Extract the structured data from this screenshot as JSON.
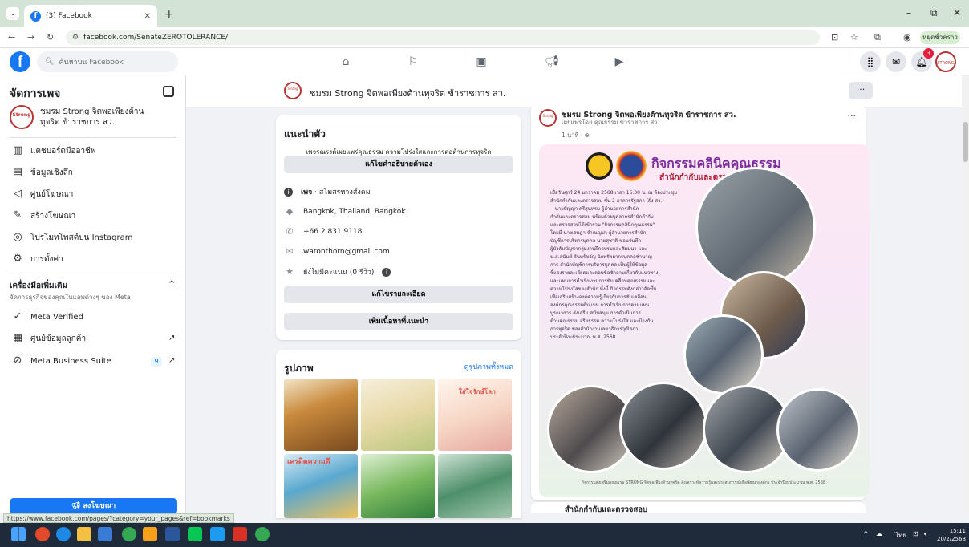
{
  "browser": {
    "tab_title": "(3) Facebook",
    "url": "facebook.com/SenateZEROTOLERANCE/",
    "profile_label": "หยุดชั่วคราว",
    "status_url": "https://www.facebook.com/pages/?category=your_pages&ref=bookmarks"
  },
  "fbnav": {
    "search_placeholder": "ค้นหาบน Facebook",
    "notification_count": "3"
  },
  "sidebar": {
    "title": "จัดการเพจ",
    "page_name": "ชมรม Strong จิตพอเพียงต้านทุจริต ข้าราชการ สว.",
    "items": [
      {
        "label": "แดชบอร์ดมืออาชีพ",
        "icon": "dashboard-icon"
      },
      {
        "label": "ข้อมูลเชิงลึก",
        "icon": "insights-icon"
      },
      {
        "label": "ศูนย์โฆษณา",
        "icon": "megaphone-icon"
      },
      {
        "label": "สร้างโฆษณา",
        "icon": "edit-icon"
      },
      {
        "label": "โปรโมทโพสต์บน Instagram",
        "icon": "instagram-icon"
      },
      {
        "label": "การตั้งค่า",
        "icon": "gear-icon"
      }
    ],
    "tools_heading": "เครื่องมือเพิ่มเติม",
    "tools_sub": "จัดการธุรกิจของคุณในแอพต่างๆ ของ Meta",
    "tools": [
      {
        "label": "Meta Verified",
        "icon": "verified-icon"
      },
      {
        "label": "ศูนย์ข้อมูลลูกค้า",
        "icon": "contacts-icon"
      },
      {
        "label": "Meta Business Suite",
        "icon": "business-suite-icon",
        "count": "9"
      }
    ],
    "promote_label": "ลงโฆษณา"
  },
  "page_header": {
    "name": "ชมรม Strong จิตพอเพียงต้านทุจริต ข้าราชการ สว.",
    "more": "···"
  },
  "intro": {
    "heading": "แนะนำตัว",
    "bio": "เพจรณรงค์เผยแพร่คุณธรรม ความโปร่งใสและการต่อต้านการทุจริต",
    "edit_bio": "แก้ไขคำอธิบายตัวเอง",
    "category_bold": "เพจ",
    "category": " · สโมสรทางสังคม",
    "location": "Bangkok, Thailand, Bangkok",
    "phone": "+66 2 831 9118",
    "email": "waronthorn@gmail.com",
    "rating": "ยังไม่มีคะแนน (0 รีวิว)",
    "edit_details": "แก้ไขรายละเอียด",
    "add_featured": "เพิ่มเนื้อหาที่แนะนำ"
  },
  "photos": {
    "heading": "รูปภาพ",
    "see_all": "ดูรูปภาพทั้งหมด",
    "thumb1_text": "เครดิตความดี",
    "thumb2_text": "ใส่ใจรักษ์โลก"
  },
  "post": {
    "author": "ชมรม Strong จิตพอเพียงต้านทุจริต ข้าราชการ สว.",
    "by": "เผยแพร่โดย คุณธรรม ข้าราชการ สว.",
    "time": "1 นาที · ",
    "more": "···",
    "poster_title": "กิจกรรมคลินิคคุณธรรม",
    "poster_subtitle": "สำนักกำกับและตรวจสอบ",
    "poster_body": "เมื่อวันศุกร์ 24 มกราคม 2568 เวลา 15.00 น. ณ ห้องประชุม\nสำนักกำกับและตรวจสอบ ชั้น 2 อาคารรัฐสภา (ฝั่ง สว.)\n   นายปัญญา ศรีสุนทรม ผู้อำนวยการสำนัก\nกำกับและตรวจสอบ พร้อมด้วยบุคลากรสำนักกำกับ\nและตรวจสอบได้เข้าร่วม \"กิจกรรมคลินิกคุณธรรม\"\nโดยมี นางเจษฎา จำเนญปา ผู้อำนวยการสำนัก\nบัญชีการบริหารบุคคล นายสุชาติ ขอมจันทึก\nผู้บังคับบัญชากลุ่มงานฝึกอบรมและสัมมนา และ\nน.ส.สุนันท์ จันทร์ขวัญ นักทรัพยากรบุคคลชำนาญ\nการ สำนักบัญชีการบริหารบุคคล เป็นผู้ให้ข้อมูล\nชี้แจงรายละเอียดและตอบข้อซักถามเกี่ยวกับแนวทาง\nและแผนการดำเนินงานการขับเคลื่อนคุณธรรมและ\nความโปร่งใสของสำนัก ทั้งนี้ กิจกรรมดังกล่าวจัดขึ้น\nเพื่อเสริมสร้างองค์ความรู้เกี่ยวกับการขับเคลื่อน\nองค์กรคุณธรรมต้นแบบ การดำเนินการตามแผน\nบูรณาการ ส่งเสริม สนับสนุน การดำเนินการ\nด้านคุณธรรม จริยธรรม ความโปร่งใส และป้องกัน\nการทุจริต ของสำนักงานเลขาธิการวุฒิสภา\nประจำปีงบประมาณ พ.ศ. 2568",
    "poster_caption": "กิจกรรมส่งเสริมคุณธรรม STRONG จิตพอเพียงต้านทุจริต สังเคราะห์ความรู้และประสบการณ์เพื่อพัฒนาองค์กร ประจำปีงบประมาณ พ.ศ. 2568"
  },
  "next_post": {
    "author": "สำนักกำกับและตรวจสอบ"
  },
  "taskbar": {
    "lang": "ไทย",
    "time": "15:11",
    "date": "20/2/2568"
  }
}
